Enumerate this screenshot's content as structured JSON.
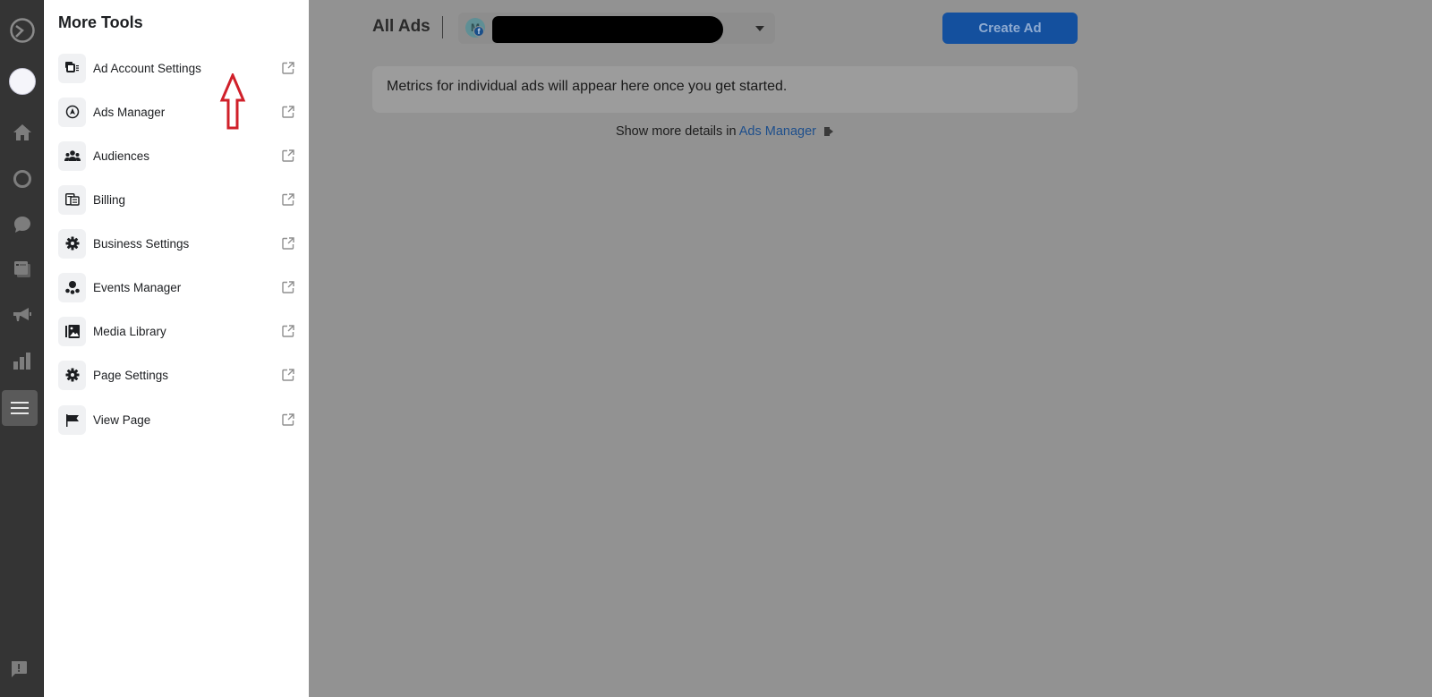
{
  "rail": {
    "items": [
      {
        "name": "business-suite-logo-icon"
      },
      {
        "name": "profile-avatar"
      },
      {
        "name": "home-icon"
      },
      {
        "name": "activity-history-icon"
      },
      {
        "name": "inbox-icon"
      },
      {
        "name": "posts-icon"
      },
      {
        "name": "ads-megaphone-icon"
      },
      {
        "name": "insights-icon"
      },
      {
        "name": "all-tools-menu-icon",
        "active": true
      }
    ],
    "help_icon": "feedback-icon"
  },
  "panel": {
    "title": "More Tools",
    "items": [
      {
        "label": "Ad Account Settings",
        "icon": "ad-account-icon"
      },
      {
        "label": "Ads Manager",
        "icon": "ads-manager-icon"
      },
      {
        "label": "Audiences",
        "icon": "audiences-icon"
      },
      {
        "label": "Billing",
        "icon": "billing-icon"
      },
      {
        "label": "Business Settings",
        "icon": "gear-icon"
      },
      {
        "label": "Events Manager",
        "icon": "events-manager-icon"
      },
      {
        "label": "Media Library",
        "icon": "media-library-icon"
      },
      {
        "label": "Page Settings",
        "icon": "gear-icon"
      },
      {
        "label": "View Page",
        "icon": "flag-icon"
      }
    ]
  },
  "header": {
    "title": "All Ads",
    "account": {
      "avatar_letter": "M",
      "badge": "f",
      "name": "[redacted]"
    },
    "create_button": "Create Ad"
  },
  "main": {
    "metrics_message": "Metrics for individual ads will appear here once you get started.",
    "details_prefix": "Show more details in",
    "details_link": "Ads Manager"
  },
  "colors": {
    "primary_button": "#14509e",
    "link": "#1e4f8c",
    "annotation_arrow": "#d0202a",
    "rail_bg": "#343434",
    "overlay_bg": "#929292"
  }
}
